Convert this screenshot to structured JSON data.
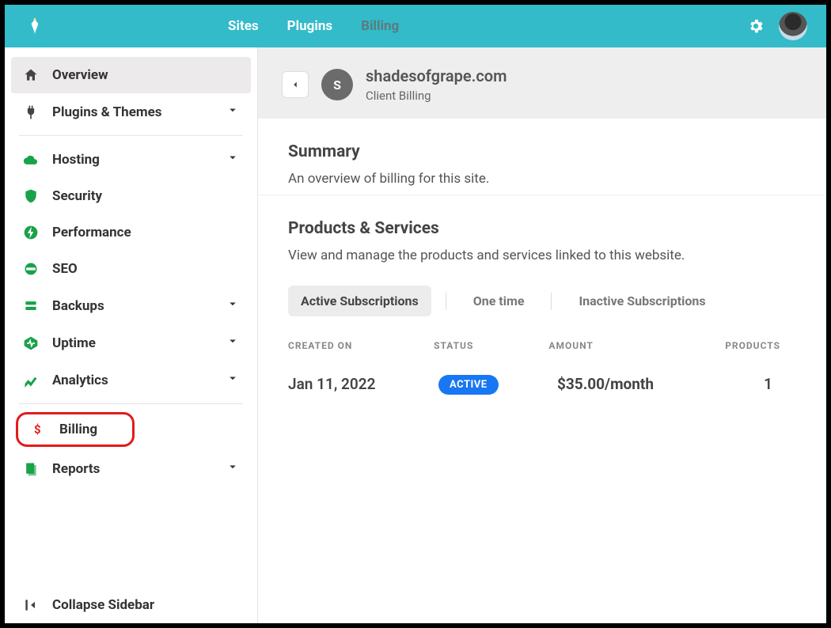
{
  "topnav": {
    "items": [
      {
        "label": "Sites",
        "active": true
      },
      {
        "label": "Plugins",
        "active": true
      },
      {
        "label": "Billing",
        "active": false
      }
    ]
  },
  "sidebar": {
    "overview": "Overview",
    "plugins_themes": "Plugins & Themes",
    "hosting": "Hosting",
    "security": "Security",
    "performance": "Performance",
    "seo": "SEO",
    "backups": "Backups",
    "uptime": "Uptime",
    "analytics": "Analytics",
    "billing": "Billing",
    "reports": "Reports",
    "collapse": "Collapse Sidebar"
  },
  "page": {
    "site_initial": "S",
    "site_name": "shadesofgrape.com",
    "site_sub": "Client Billing"
  },
  "summary": {
    "heading": "Summary",
    "text": "An overview of billing for this site."
  },
  "products": {
    "heading": "Products & Services",
    "text": "View and manage the products and services linked to this website.",
    "tabs": {
      "active_subs": "Active Subscriptions",
      "one_time": "One time",
      "inactive_subs": "Inactive Subscriptions"
    },
    "columns": {
      "created": "CREATED ON",
      "status": "STATUS",
      "amount": "AMOUNT",
      "products": "PRODUCTS"
    },
    "rows": [
      {
        "created": "Jan 11, 2022",
        "status": "ACTIVE",
        "amount": "$35.00/month",
        "products": "1"
      }
    ]
  }
}
